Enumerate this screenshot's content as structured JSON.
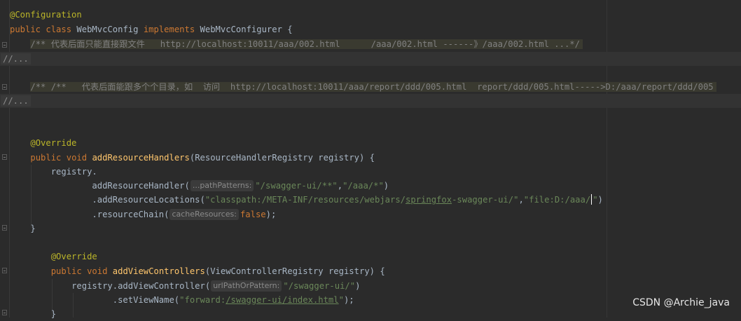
{
  "code": {
    "l1_annotation": "@Configuration",
    "l2_public": "public",
    "l2_class": "class",
    "l2_name": "WebMvcConfig",
    "l2_implements": "implements",
    "l2_iface": "WebMvcConfigurer {",
    "l3_comment": "/** 代表后面只能直接跟文件   http://localhost:10011/aaa/002.html      /aaa/002.html ------》/aaa/002.html ...*/",
    "l4_folded": "//...",
    "l5_comment": "/** /**   代表后面能跟多个个目录，如  访问  http://localhost:10011/aaa/report/ddd/005.html  report/ddd/005.html----->D:/aaa/report/ddd/005",
    "l6_folded": "//...",
    "l7_annotation": "@Override",
    "l8_public": "public",
    "l8_void": "void",
    "l8_method": "addResourceHandlers",
    "l8_params": "(ResourceHandlerRegistry registry) {",
    "l9_text": "registry.",
    "l10_call": "addResourceHandler(",
    "l10_hint": "...pathPatterns:",
    "l10_arg1": "\"/swagger-ui/**\"",
    "l10_comma": ",",
    "l10_arg2": "\"/aaa/*\"",
    "l10_end": ")",
    "l11_call": ".addResourceLocations(",
    "l11_arg1_a": "\"classpath:/META-INF/resources/webjars/",
    "l11_arg1_u": "springfox",
    "l11_arg1_b": "-swagger-ui/\"",
    "l11_comma": ",",
    "l11_arg2_a": "\"file:D:/aaa/",
    "l11_arg2_b": "\"",
    "l11_end": ")",
    "l12_call": ".resourceChain(",
    "l12_hint": "cacheResources:",
    "l12_arg": "false",
    "l12_end": ");",
    "l13_brace": "}",
    "l14_annotation": "@Override",
    "l15_public": "public",
    "l15_void": "void",
    "l15_method": "addViewControllers",
    "l15_params": "(ViewControllerRegistry registry) {",
    "l16_call": "registry.addViewController(",
    "l16_hint": "urlPathOrPattern:",
    "l16_arg": "\"/swagger-ui/\"",
    "l16_end": ")",
    "l17_call": ".setViewName(",
    "l17_arg_a": "\"forward:",
    "l17_arg_u": "/swagger-ui/index.html",
    "l17_arg_b": "\"",
    "l17_end": ");",
    "l18_brace": "}"
  },
  "watermark": "CSDN @Archie_java",
  "colors": {
    "background": "#2b2b2b",
    "keyword": "#cc7832",
    "annotation": "#bbb529",
    "method": "#ffc66d",
    "string": "#6a8759",
    "comment": "#808080",
    "text": "#a9b7c6",
    "hint": "#8a8a8a"
  }
}
